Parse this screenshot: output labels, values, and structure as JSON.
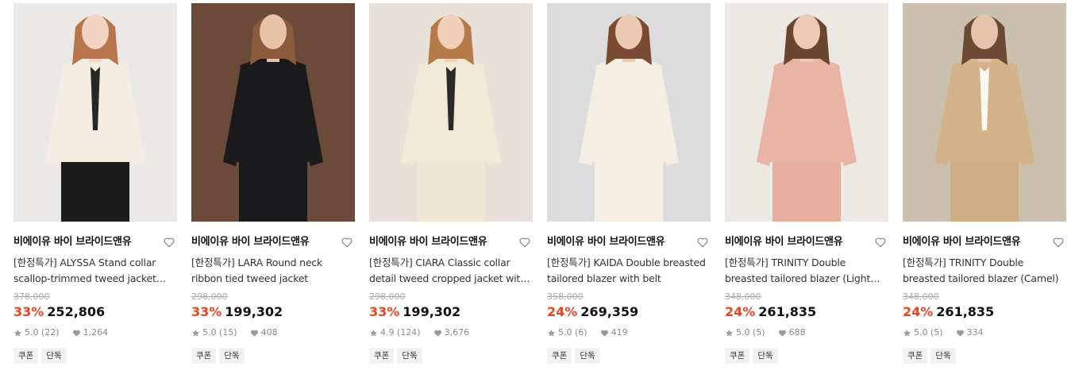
{
  "products": [
    {
      "brand": "비에이유 바이 브라이드앤유",
      "title": "[한정특가] ALYSSA Stand collar scallop-trimmed tweed jacket with ribbon",
      "original_price": "378,000",
      "discount": "33%",
      "price": "252,806",
      "rating": "5.0 (22)",
      "likes": "1,264",
      "tags": [
        "쿠폰",
        "단독"
      ],
      "image": {
        "bg": "#ebe9e7",
        "garment": "#f3ede2",
        "accent": "#111111",
        "hair": "#b9764c",
        "skin": "#f2d4c2",
        "bottom": "#1b1b1b"
      }
    },
    {
      "brand": "비에이유 바이 브라이드앤유",
      "title": "[한정특가] LARA Round neck ribbon tied tweed jacket",
      "original_price": "298,000",
      "discount": "33%",
      "price": "199,302",
      "rating": "5.0 (15)",
      "likes": "408",
      "tags": [
        "쿠폰",
        "단독"
      ],
      "image": {
        "bg": "#6b4a3a",
        "garment": "#1a1a1d",
        "accent": "#1a1a1d",
        "hair": "#8a5a3a",
        "skin": "#e7c2a8",
        "bottom": "#1a1a1d"
      }
    },
    {
      "brand": "비에이유 바이 브라이드앤유",
      "title": "[한정특가] CIARA Classic collar detail tweed cropped jacket with ribbon",
      "original_price": "298,000",
      "discount": "33%",
      "price": "199,302",
      "rating": "4.9 (124)",
      "likes": "3,676",
      "tags": [
        "쿠폰",
        "단독"
      ],
      "image": {
        "bg": "#e7e1d9",
        "garment": "#f2ead6",
        "accent": "#141414",
        "hair": "#b57a48",
        "skin": "#efcfb8",
        "bottom": "#efe6d3"
      }
    },
    {
      "brand": "비에이유 바이 브라이드앤유",
      "title": "[한정특가] KAIDA Double breasted tailored blazer with belt",
      "original_price": "358,000",
      "discount": "24%",
      "price": "269,359",
      "rating": "5.0 (6)",
      "likes": "419",
      "tags": [
        "쿠폰",
        "단독"
      ],
      "image": {
        "bg": "#dcdcdc",
        "garment": "#f4efe2",
        "accent": "#f4efe2",
        "hair": "#7a4a33",
        "skin": "#ebc9b3",
        "bottom": "#f4efe2"
      }
    },
    {
      "brand": "비에이유 바이 브라이드앤유",
      "title": "[한정특가] TRINITY Double breasted tailored blazer (Light Pink)",
      "original_price": "348,000",
      "discount": "24%",
      "price": "261,835",
      "rating": "5.0 (5)",
      "likes": "688",
      "tags": [
        "쿠폰",
        "단독"
      ],
      "image": {
        "bg": "#ece9e5",
        "garment": "#e9b3a6",
        "accent": "#e9b3a6",
        "hair": "#6b4530",
        "skin": "#eccab6",
        "bottom": "#e7ae9f"
      }
    },
    {
      "brand": "비에이유 바이 브라이드앤유",
      "title": "[한정특가] TRINITY Double breasted tailored blazer (Camel)",
      "original_price": "348,000",
      "discount": "24%",
      "price": "261,835",
      "rating": "5.0 (5)",
      "likes": "334",
      "tags": [
        "쿠폰",
        "단독"
      ],
      "image": {
        "bg": "#cbbfae",
        "garment": "#d2b288",
        "accent": "#ffffff",
        "hair": "#6b4a35",
        "skin": "#e6c3aa",
        "bottom": "#cfae84"
      }
    }
  ]
}
